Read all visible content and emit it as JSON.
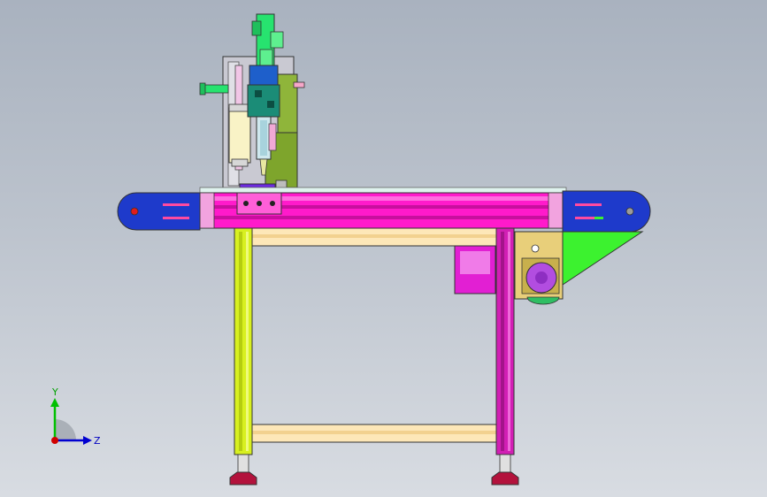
{
  "viewport": {
    "background_top": "#a9b2bf",
    "background_bottom": "#d8dce2"
  },
  "triad": {
    "y_label": "Y",
    "z_label": "Z",
    "y_color": "#00c000",
    "z_color": "#0000d0",
    "x_color": "#d00000"
  },
  "model": {
    "colors": {
      "frame_magenta": "#ff1acb",
      "end_cap_blue": "#1e3acb",
      "leg_yellow": "#d8f020",
      "leg_purple": "#d21fb4",
      "cylinder_green": "#27e36f",
      "bracket_olive": "#8fb53a",
      "rail_cream": "#fde7b8",
      "foot_crimson": "#b3123c",
      "motor_violet": "#b24de0",
      "gearbox_tan": "#e8cf7a",
      "support_green": "#3cf22f",
      "motor_box_magenta": "#e21fd3"
    }
  }
}
